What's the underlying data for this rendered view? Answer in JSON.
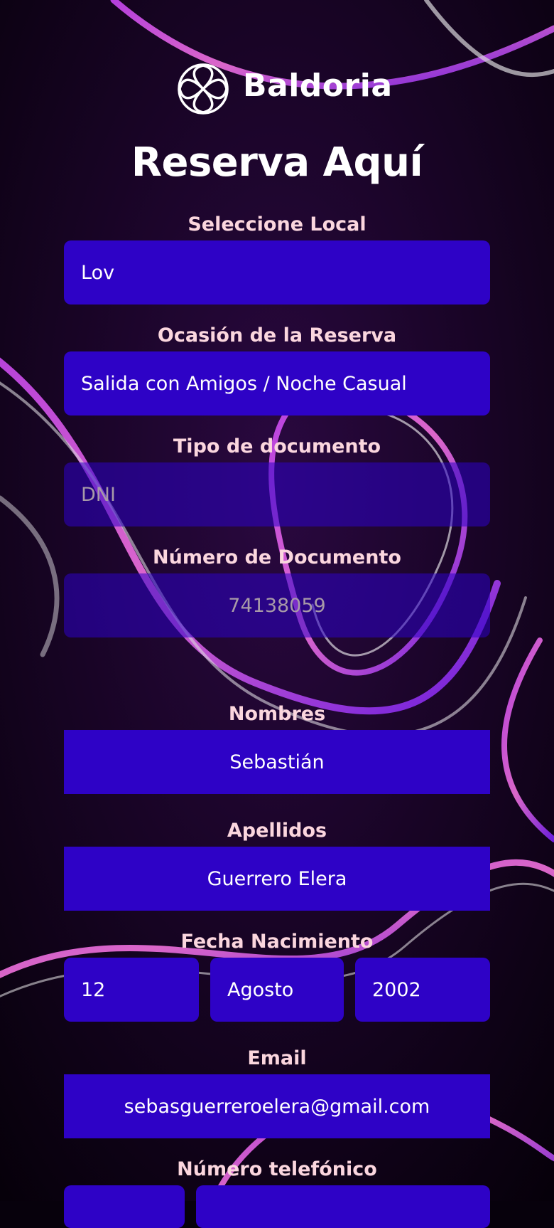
{
  "brand": {
    "name": "Baldoria"
  },
  "page": {
    "title": "Reserva Aquí"
  },
  "form": {
    "local": {
      "label": "Seleccione Local",
      "value": "Lov"
    },
    "occasion": {
      "label": "Ocasión de la Reserva",
      "value": "Salida con Amigos / Noche Casual"
    },
    "doc_type": {
      "label": "Tipo de documento",
      "value": "DNI"
    },
    "doc_number": {
      "label": "Número de Documento",
      "value": "74138059"
    },
    "first_name": {
      "label": "Nombres",
      "value": "Sebastián"
    },
    "last_name": {
      "label": "Apellidos",
      "value": "Guerrero Elera"
    },
    "birth": {
      "label": "Fecha Nacimiento",
      "day": "12",
      "month": "Agosto",
      "year": "2002"
    },
    "email": {
      "label": "Email",
      "value": "sebasguerreroelera@gmail.com"
    },
    "phone": {
      "label": "Número telefónico"
    }
  },
  "colors": {
    "field": "#2e02c6",
    "label": "#fbd6de",
    "title": "#ffffff",
    "background": "#07010c"
  },
  "icons": {
    "logo": "globe-flower-icon"
  }
}
